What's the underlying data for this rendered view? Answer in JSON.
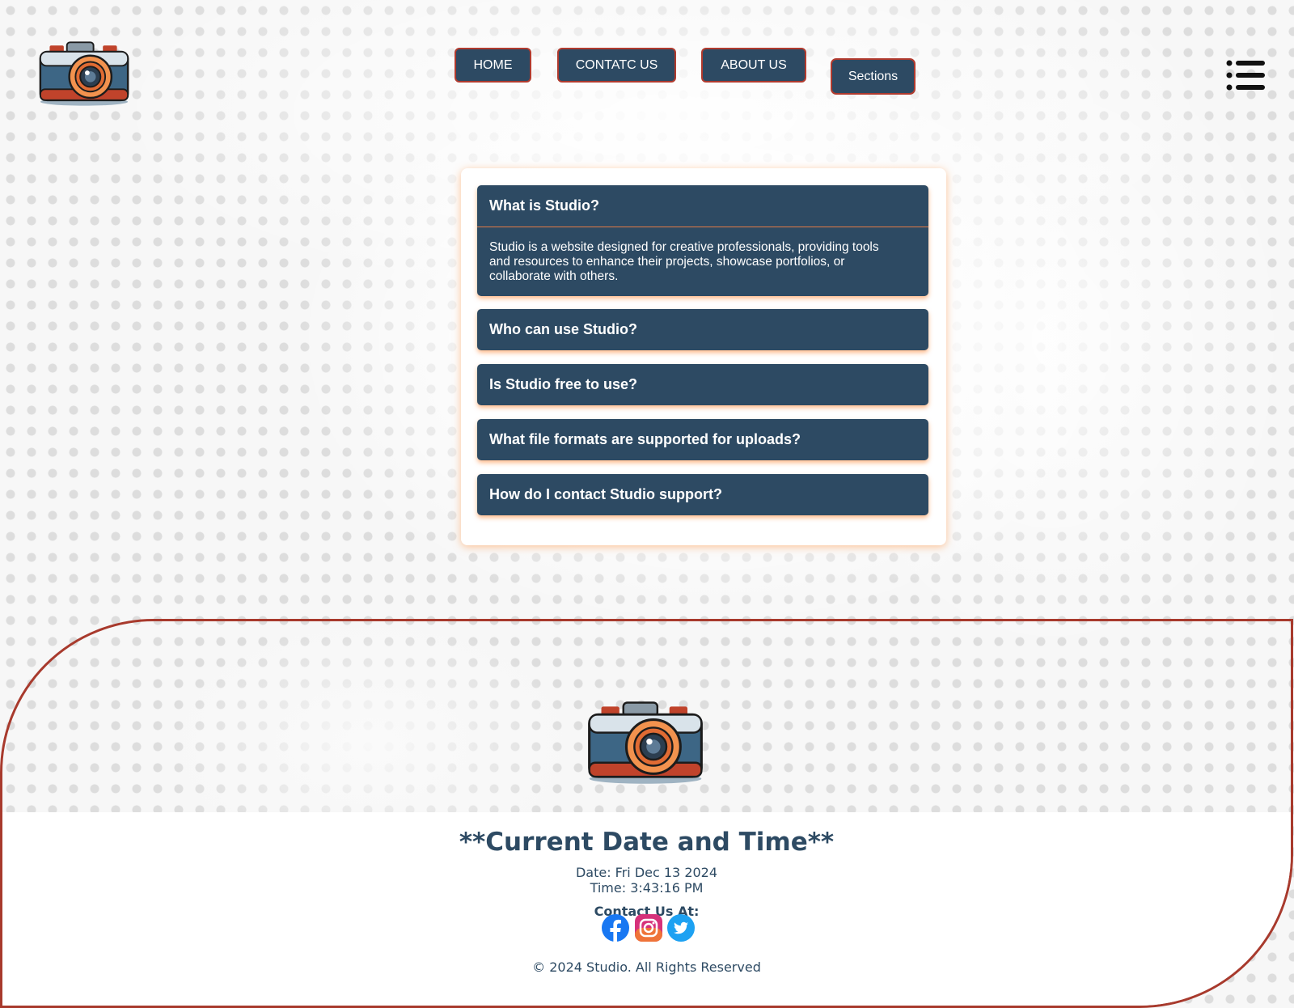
{
  "nav": {
    "items": [
      {
        "label": "HOME"
      },
      {
        "label": "CONTATC US"
      },
      {
        "label": "ABOUT US"
      },
      {
        "label": "Sections"
      }
    ],
    "logo_icon": "camera-icon",
    "menu_icon": "list-menu-icon"
  },
  "faq": {
    "items": [
      {
        "question": "What is Studio?",
        "answer": "Studio is a website designed for creative professionals, providing tools and resources to enhance their projects, showcase portfolios, or collaborate with others.",
        "expanded": true
      },
      {
        "question": "Who can use Studio?",
        "expanded": false
      },
      {
        "question": "Is Studio free to use?",
        "expanded": false
      },
      {
        "question": "What file formats are supported for uploads?",
        "expanded": false
      },
      {
        "question": "How do I contact Studio support?",
        "expanded": false
      }
    ]
  },
  "footer": {
    "datetime_title": "**Current Date and Time**",
    "date": "Date: Fri Dec 13 2024",
    "time": "Time: 3:43:16 PM",
    "contact_label": "Contact Us At:",
    "social": [
      "facebook-icon",
      "instagram-icon",
      "twitter-icon"
    ],
    "copyright": "© 2024 Studio. All Rights Reserved"
  },
  "colors": {
    "primary": "#2d4a63",
    "border_accent": "#b03a2e",
    "glow": "#ff9a4a"
  }
}
